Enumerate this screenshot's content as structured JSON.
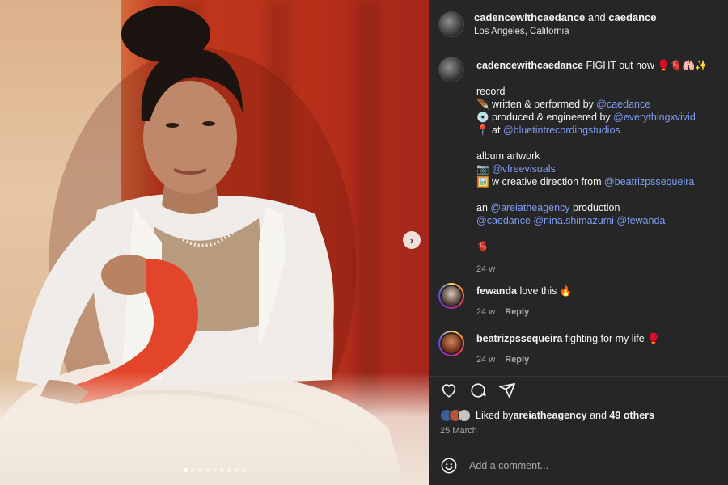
{
  "post": {
    "author": "cadencewithcaedance",
    "joiner": "and",
    "collaborator": "caedance",
    "location": "Los Angeles, California"
  },
  "caption": {
    "author": "cadencewithcaedance",
    "text_first": " FIGHT out now 🥊🫀🫁✨",
    "record_heading": "record",
    "written_prefix": "🪶 written & performed by ",
    "written_mention": "@caedance",
    "produced_prefix": "💿 produced & engineered by ",
    "produced_mention": "@everythingxvivid",
    "at_prefix": "📍 at ",
    "at_mention": "@bluetintrecordingstudios",
    "artwork_heading": "album artwork",
    "camera_prefix": "📷 ",
    "camera_mention": "@vfreevisuals",
    "direction_prefix": "🖼️ w creative direction from ",
    "direction_mention": "@beatrizpssequeira",
    "an_prefix": "an ",
    "an_mention": "@areiatheagency",
    "an_suffix": " production",
    "credit_m1": "@caedance",
    "credit_m2": "@nina.shimazumi",
    "credit_m3": "@fewanda",
    "closing_emoji": "🫀",
    "time": "24 w"
  },
  "comments": [
    {
      "user": "fewanda",
      "text": " love this 🔥",
      "time": "24 w",
      "reply_label": "Reply"
    },
    {
      "user": "beatrizpssequeira",
      "text": " fighting for my life 🥊",
      "time": "24 w",
      "reply_label": "Reply"
    }
  ],
  "likes": {
    "prefix": "Liked by ",
    "user": "areiatheagency",
    "joiner": " and ",
    "others": "49 others"
  },
  "date": "25 March",
  "add_comment": {
    "placeholder": "Add a comment..."
  },
  "carousel": {
    "slide_count": 9,
    "active_index": 0,
    "next_glyph": "›"
  },
  "icons": {
    "like": "heart-icon",
    "comment": "speech-bubble-icon",
    "share": "paper-plane-icon",
    "emoji": "smiley-icon",
    "next": "chevron-right-icon"
  },
  "colors": {
    "background": "#262626",
    "mention": "#7e9cf2",
    "muted": "#a8a8a8"
  }
}
